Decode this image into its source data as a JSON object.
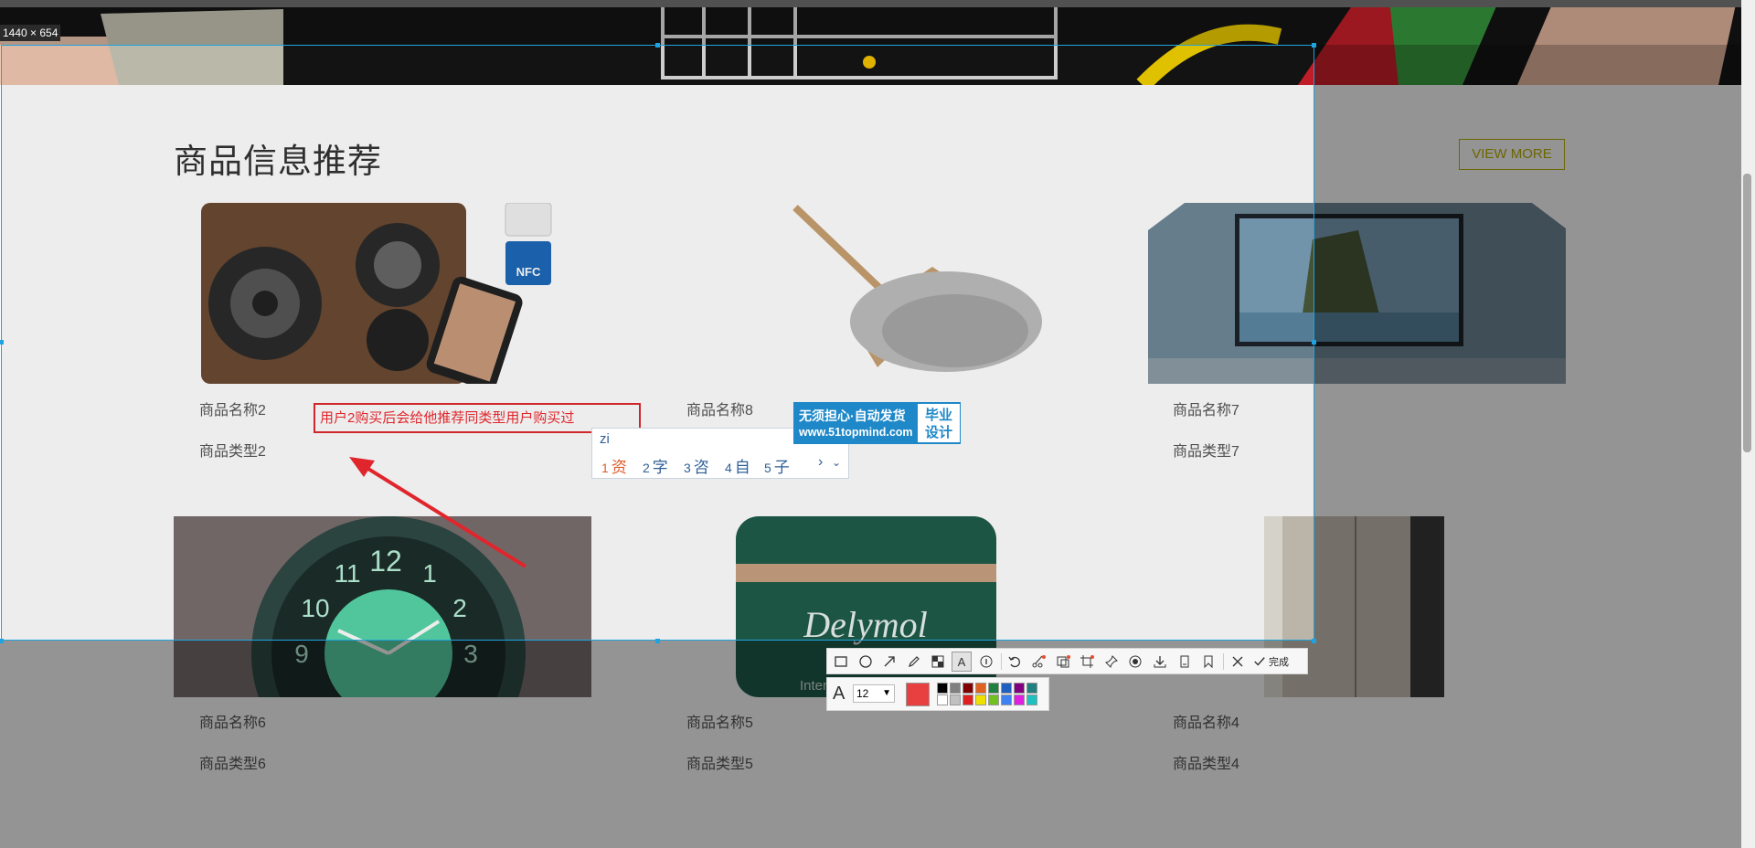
{
  "capture": {
    "size_label": "1440 × 654"
  },
  "page": {
    "section_title": "商品信息推荐",
    "view_more": "VIEW MORE",
    "products": [
      {
        "name": "商品名称2",
        "type": "商品类型2"
      },
      {
        "name": "商品名称8",
        "type": ""
      },
      {
        "name": "商品名称7",
        "type": "商品类型7"
      },
      {
        "name": "商品名称6",
        "type": "商品类型6"
      },
      {
        "name": "商品名称5",
        "type": "商品类型5"
      },
      {
        "name": "商品名称4",
        "type": "商品类型4"
      }
    ],
    "speaker_badges": [
      "NFC"
    ],
    "jar_brand": "Delymol",
    "jar_sub": "Intensive"
  },
  "annotation": {
    "text": "用户2购买后会给他推荐同类型用户购买过",
    "color": "#e0262c"
  },
  "ime": {
    "input": "zi",
    "candidates": [
      {
        "num": "1",
        "char": "资"
      },
      {
        "num": "2",
        "char": "字"
      },
      {
        "num": "3",
        "char": "咨"
      },
      {
        "num": "4",
        "char": "自"
      },
      {
        "num": "5",
        "char": "子"
      }
    ]
  },
  "ad": {
    "line1": "无须担心·自动发货",
    "line2": "www.51topmind.com",
    "right1": "毕业",
    "right2": "设计"
  },
  "toolbar": {
    "done_label": "完成",
    "font_size": "12",
    "tools": [
      "rectangle-icon",
      "ellipse-icon",
      "arrow-icon",
      "pen-icon",
      "mosaic-icon",
      "text-icon",
      "serial-number-icon",
      "undo-icon",
      "cut-icon",
      "ocr-icon",
      "crop-icon",
      "pin-icon",
      "record-icon",
      "download-icon",
      "copy-icon",
      "bookmark-icon"
    ],
    "current_color": "#e84040",
    "palette_top": [
      "#000000",
      "#808080",
      "#800000",
      "#e06020",
      "#208040",
      "#2060c0",
      "#800080",
      "#208080"
    ],
    "palette_bottom": [
      "#ffffff",
      "#c0c0c0",
      "#e02020",
      "#f0e000",
      "#70c020",
      "#4080f0",
      "#e020e0",
      "#20c0c0"
    ]
  }
}
